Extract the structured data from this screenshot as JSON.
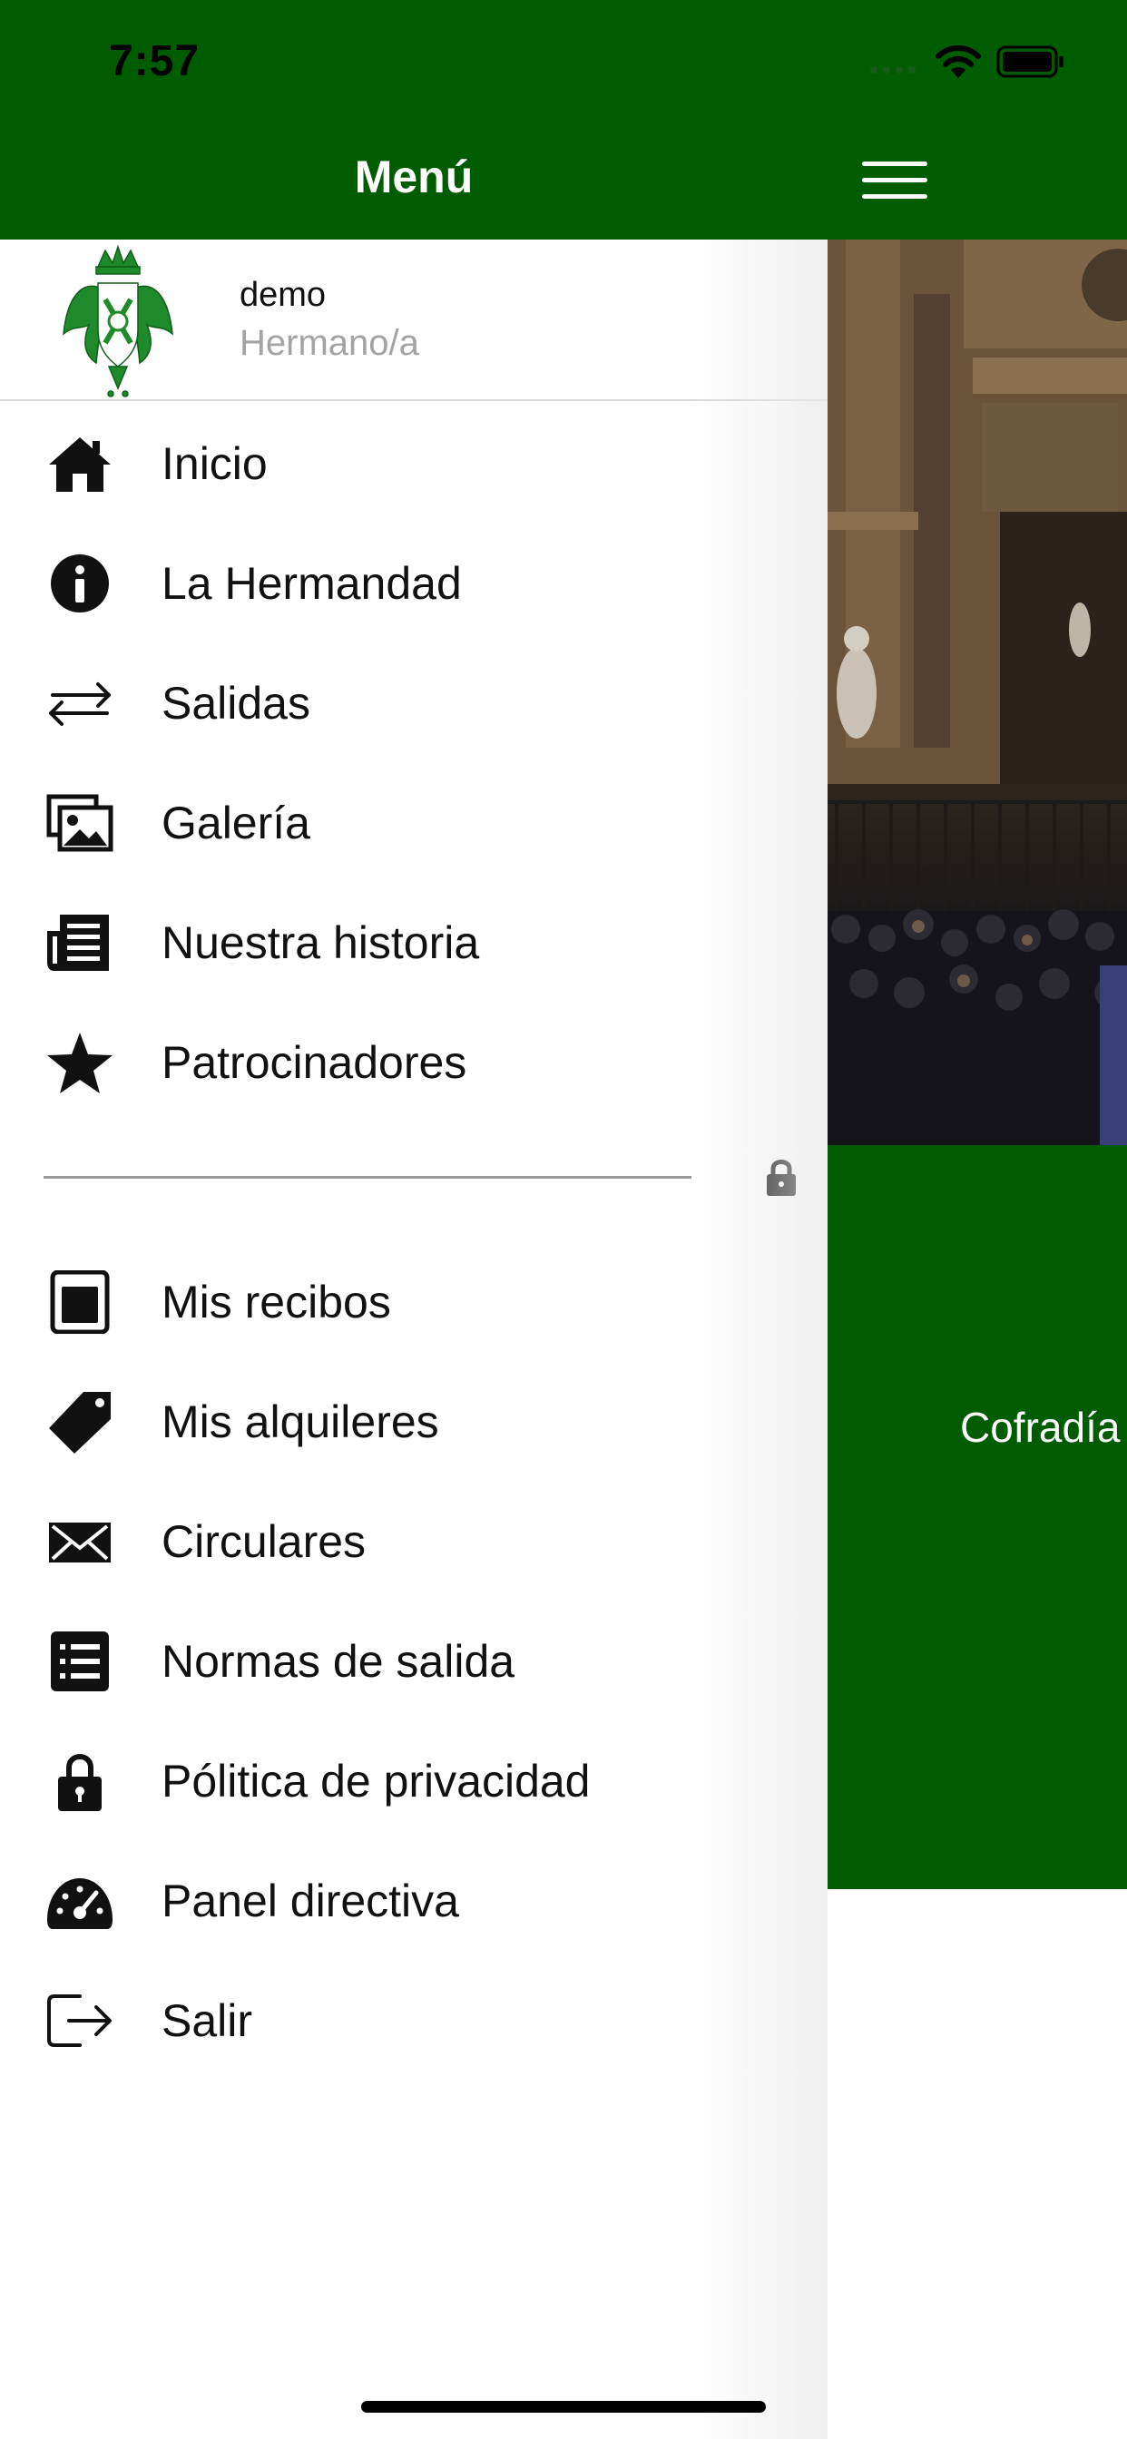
{
  "status_bar": {
    "time": "7:57"
  },
  "drawer": {
    "title": "Menú",
    "profile": {
      "name": "demo",
      "role": "Hermano/a"
    },
    "public_items": [
      {
        "label": "Inicio",
        "icon": "home-icon"
      },
      {
        "label": "La Hermandad",
        "icon": "info-icon"
      },
      {
        "label": "Salidas",
        "icon": "arrows-exchange-icon"
      },
      {
        "label": "Galería",
        "icon": "images-icon"
      },
      {
        "label": "Nuestra historia",
        "icon": "newspaper-icon"
      },
      {
        "label": "Patrocinadores",
        "icon": "star-icon"
      }
    ],
    "private_items": [
      {
        "label": "Mis recibos",
        "icon": "receipt-icon"
      },
      {
        "label": "Mis alquileres",
        "icon": "tag-icon"
      },
      {
        "label": "Circulares",
        "icon": "envelope-icon"
      },
      {
        "label": "Normas de salida",
        "icon": "list-icon"
      },
      {
        "label": "Pólitica de privacidad",
        "icon": "lock-icon"
      },
      {
        "label": "Panel directiva",
        "icon": "dashboard-icon"
      },
      {
        "label": "Salir",
        "icon": "sign-out-icon"
      }
    ]
  },
  "main": {
    "band_text": "Cofradía"
  },
  "colors": {
    "primary_green": "#005c00",
    "text_primary": "#111111",
    "text_secondary": "#a3a3a3",
    "divider": "#9a9a9a"
  }
}
